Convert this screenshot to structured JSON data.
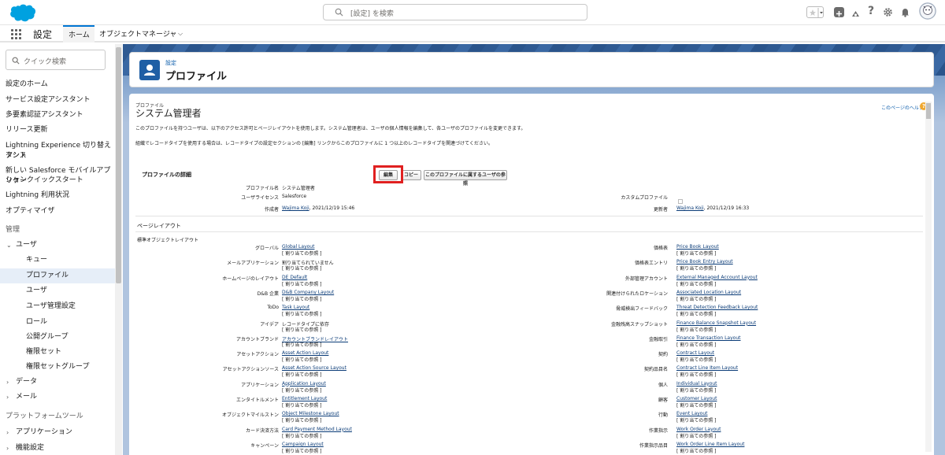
{
  "header": {
    "search_placeholder": "[設定] を検索"
  },
  "nav": {
    "app_name": "設定",
    "tab_home": "ホーム",
    "tab_object_manager": "オブジェクトマネージャ"
  },
  "sidebar": {
    "quick_search_placeholder": "クイック検索",
    "items": [
      "設定のホーム",
      "サービス設定アシスタント",
      "多要素認証アシスタント",
      "リリース更新",
      "Lightning Experience 切り替えアシス",
      "タント",
      "新しい Salesforce モバイルアプリケー",
      "ションクイックスタート",
      "Lightning 利用状況",
      "オプティマイザ"
    ],
    "section_admin": "管理",
    "users": "ユーザ",
    "user_children": [
      "キュー",
      "プロファイル",
      "ユーザ",
      "ユーザ管理設定",
      "ロール",
      "公開グループ",
      "権限セット",
      "権限セットグループ"
    ],
    "data": "データ",
    "mail": "メール",
    "section_platform": "プラットフォームツール",
    "apps": "アプリケーション",
    "features": "機能設定"
  },
  "page_header": {
    "label": "設定",
    "title": "プロファイル"
  },
  "content": {
    "small_label": "プロファイル",
    "title": "システム管理者",
    "help_link": "このページのヘルプ",
    "help_icon": "?",
    "desc1": "このプロファイルを持つユーザは、以下のアクセス許可とページレイアウトを使用します。システム管理者は、ユーザの個人情報を編集して、各ユーザのプロファイルを変更できます。",
    "desc2": "組織でレコードタイプを使用する場合は、レコードタイプの設定セクションの [編集] リンクからこのプロファイルに 1 つ以上のレコードタイプを関連づけてください。",
    "detail_title": "プロファイルの詳細",
    "btn_edit": "編集",
    "btn_copy": "コピー",
    "btn_users": "このプロファイルに属するユーザの参照",
    "detail": {
      "profile_name_label": "プロファイル名",
      "profile_name": "システム管理者",
      "license_label": "ユーザライセンス",
      "license": "Salesforce",
      "custom_label": "カスタムプロファイル",
      "created_label": "作成者",
      "created_by": "Wajima Koji",
      "created_at": ", 2021/12/19 15:46",
      "modified_label": "更新者",
      "modified_by": "Wajima Koji",
      "modified_at": ", 2021/12/19 16:33"
    },
    "layout_section": "ページレイアウト",
    "layout_sub": "標準オブジェクトレイアウト",
    "ref_label": "[ 割り当ての参照 ]",
    "left_rows": [
      {
        "label": "グローバル",
        "value": "Global Layout",
        "link": true
      },
      {
        "label": "メールアプリケーション",
        "value": "割り当てられていません",
        "link": false
      },
      {
        "label": "ホームページのレイアウト",
        "value": "DE Default",
        "link": true
      },
      {
        "label": "D&B 企業",
        "value": "D&B Company Layout",
        "link": true
      },
      {
        "label": "ToDo",
        "value": "Task Layout",
        "link": true
      },
      {
        "label": "アイデア",
        "value": "レコードタイプに依存",
        "link": false
      },
      {
        "label": "アカウントブランド",
        "value": "アカウントブランドレイアウト",
        "link": true
      },
      {
        "label": "アセットアクション",
        "value": "Asset Action Layout",
        "link": true
      },
      {
        "label": "アセットアクションソース",
        "value": "Asset Action Source Layout",
        "link": true
      },
      {
        "label": "アプリケーション",
        "value": "Application Layout",
        "link": true
      },
      {
        "label": "エンタイトルメント",
        "value": "Entitlement Layout",
        "link": true
      },
      {
        "label": "オブジェクトマイルストン",
        "value": "Object Milestone Layout",
        "link": true
      },
      {
        "label": "カード決済方法",
        "value": "Card Payment Method Layout",
        "link": true
      },
      {
        "label": "キャンペーン",
        "value": "Campaign Layout",
        "link": true
      }
    ],
    "right_rows": [
      {
        "label": "価格表",
        "value": "Price Book Layout"
      },
      {
        "label": "価格表エントリ",
        "value": "Price Book Entry Layout"
      },
      {
        "label": "外部管理アカウント",
        "value": "External Managed Account Layout"
      },
      {
        "label": "関連付けられたロケーション",
        "value": "Associated Location Layout"
      },
      {
        "label": "脅威検出フィードバック",
        "value": "Threat Detection Feedback Layout"
      },
      {
        "label": "金融残高スナップショット",
        "value": "Finance Balance Snapshot Layout"
      },
      {
        "label": "金融取引",
        "value": "Finance Transaction Layout"
      },
      {
        "label": "契約",
        "value": "Contract Layout"
      },
      {
        "label": "契約品目名",
        "value": "Contract Line Item Layout"
      },
      {
        "label": "個人",
        "value": "Individual Layout"
      },
      {
        "label": "顧客",
        "value": "Customer Layout"
      },
      {
        "label": "行動",
        "value": "Event Layout"
      },
      {
        "label": "作業指示",
        "value": "Work Order Layout"
      },
      {
        "label": "作業指示品目",
        "value": "Work Order Line Item Layout"
      }
    ]
  },
  "colors": {
    "brand": "#0176d3",
    "highlight": "#e02020",
    "link": "#0b3c78"
  }
}
